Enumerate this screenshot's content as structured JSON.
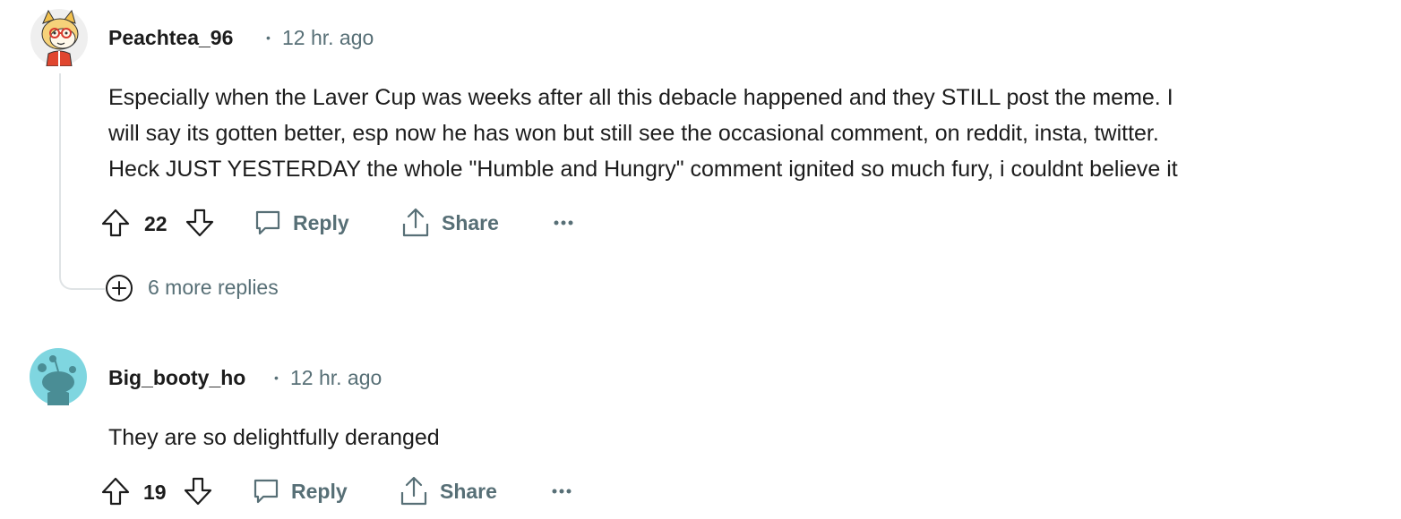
{
  "comments": [
    {
      "username": "Peachtea_96",
      "separator": "•",
      "time": "12 hr. ago",
      "lines": [
        "Especially when the Laver Cup was weeks after all this debacle happened and they STILL post the meme. I",
        "will say its gotten better, esp now he has won but still see the occasional comment, on reddit, insta, twitter.",
        "Heck JUST YESTERDAY the whole \"Humble and Hungry\" comment ignited so much fury, i couldnt believe it"
      ],
      "score": "22",
      "reply_label": "Reply",
      "share_label": "Share",
      "more_icon": "ellipsis-icon",
      "avatar_icon": "cartoon-dog-avatar-icon",
      "more_replies_label": "6 more replies"
    },
    {
      "username": "Big_booty_ho",
      "separator": "•",
      "time": "12 hr. ago",
      "lines": [
        "They are so delightfully deranged"
      ],
      "score": "19",
      "reply_label": "Reply",
      "share_label": "Share",
      "more_icon": "ellipsis-icon",
      "avatar_icon": "default-snoo-avatar-icon"
    }
  ],
  "colors": {
    "text": "#1c1c1c",
    "meta": "#576f76",
    "thread_line": "#dfe3e5",
    "snoo_bg": "#7fd6e0"
  }
}
